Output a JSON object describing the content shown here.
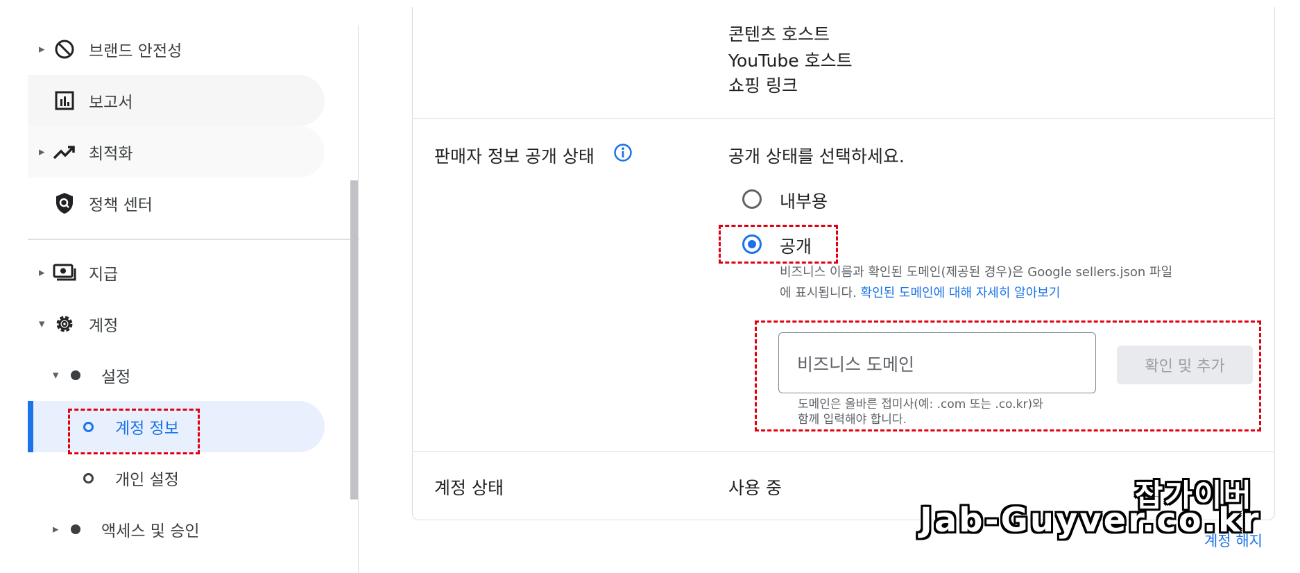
{
  "sidebar": {
    "items": [
      {
        "label": "브랜드 안전성",
        "icon": "block-icon"
      },
      {
        "label": "보고서",
        "icon": "bar-chart-icon"
      },
      {
        "label": "최적화",
        "icon": "trending-up-icon"
      },
      {
        "label": "정책 센터",
        "icon": "shield-search-icon"
      },
      {
        "label": "지급",
        "icon": "payments-icon"
      },
      {
        "label": "계정",
        "icon": "gear-icon"
      },
      {
        "label": "설정"
      },
      {
        "label": "계정 정보"
      },
      {
        "label": "개인 설정"
      },
      {
        "label": "액세스 및 승인"
      }
    ],
    "active_color": "#1a73e8"
  },
  "content": {
    "top_values": [
      "콘텐츠 호스트",
      "YouTube 호스트",
      "쇼핑 링크"
    ],
    "seller_visibility": {
      "label": "판매자 정보 공개 상태",
      "prompt": "공개 상태를 선택하세요.",
      "option_internal": "내부용",
      "option_public": "공개",
      "selected": "공개",
      "help_line1": "비즈니스 이름과 확인된 도메인(제공된 경우)은 Google sellers.json 파일",
      "help_line2_prefix": "에 표시됩니다. ",
      "help_link": "확인된 도메인에 대해 자세히 알아보기",
      "domain_placeholder": "비즈니스 도메인",
      "domain_help_line1": "도메인은 올바른 접미사(예: .com 또는 .co.kr)와",
      "domain_help_line2": "함께 입력해야 합니다.",
      "add_button": "확인 및 추가"
    },
    "account_status": {
      "label": "계정 상태",
      "value": "사용 중",
      "action": "계정 해지"
    }
  },
  "watermark": {
    "line1": "잡가이버",
    "line2": "Jab-Guyver.co.kr"
  },
  "colors": {
    "highlight": "#e0000f",
    "accent": "#1a73e8"
  }
}
